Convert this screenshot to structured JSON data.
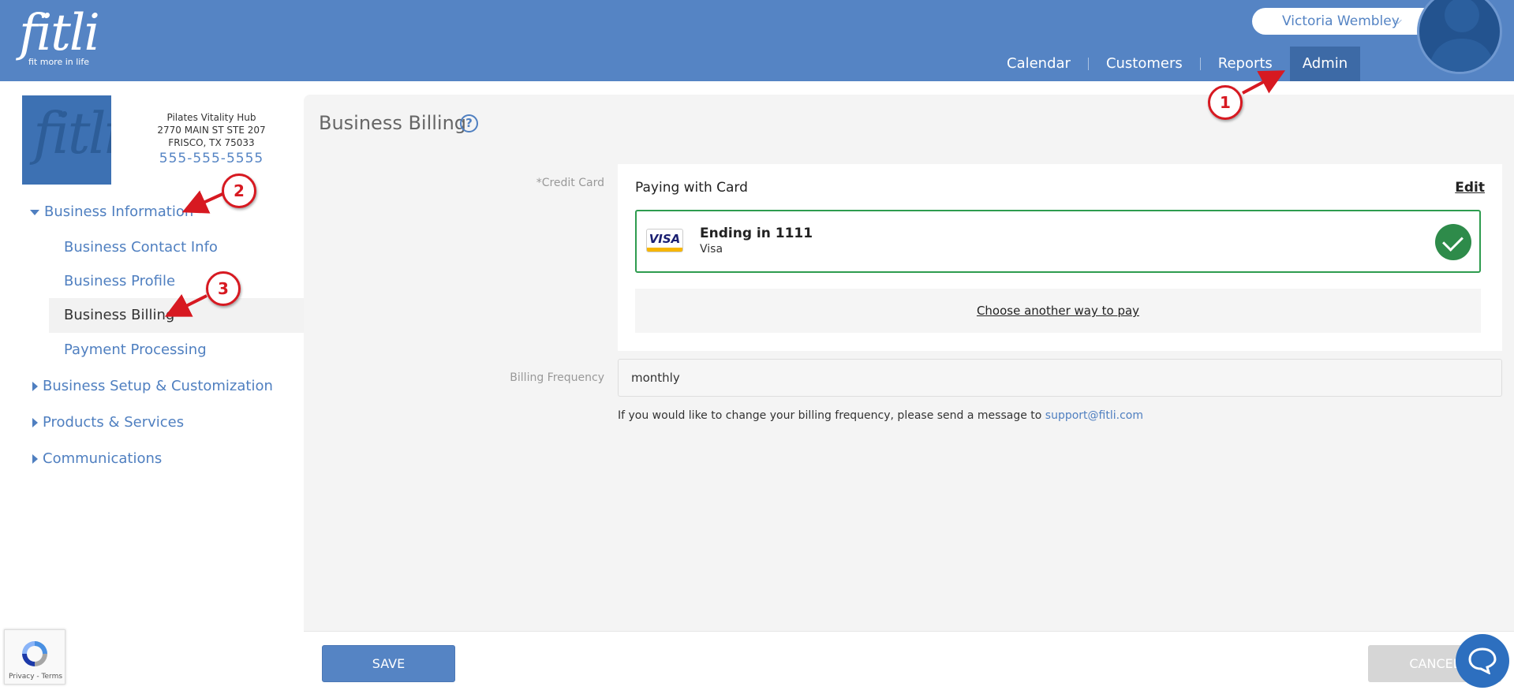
{
  "header": {
    "brand": "fitli",
    "brand_tagline": "fit more in life",
    "user_name": "Victoria Wembley",
    "nav": [
      "Calendar",
      "Customers",
      "Reports",
      "Admin"
    ],
    "active_nav": "Admin"
  },
  "business": {
    "logo": "fitli",
    "name": "Pilates Vitality Hub",
    "address_line1": "2770 MAIN ST STE 207",
    "address_line2": "FRISCO, TX 75033",
    "phone": "555-555-5555"
  },
  "sidebar": {
    "groups": [
      {
        "label": "Business Information",
        "expanded": true,
        "items": [
          "Business Contact Info",
          "Business Profile",
          "Business Billing",
          "Payment Processing"
        ]
      },
      {
        "label": "Business Setup & Customization",
        "expanded": false
      },
      {
        "label": "Products & Services",
        "expanded": false
      },
      {
        "label": "Communications",
        "expanded": false
      }
    ],
    "active_item": "Business Billing"
  },
  "page": {
    "title": "Business Billing",
    "help_icon": "?",
    "credit_card_label": "*Credit Card",
    "paying_title": "Paying with Card",
    "edit_label": "Edit",
    "card": {
      "ending": "Ending in 1111",
      "brand": "Visa",
      "logo_text": "VISA",
      "selected": true
    },
    "choose_label": "Choose another way to pay",
    "billing_frequency_label": "Billing Frequency",
    "billing_frequency_value": "monthly",
    "note_text": "If you would like to change your billing frequency, please send a message to ",
    "support_email": "support@fitli.com"
  },
  "footer": {
    "save_label": "SAVE",
    "cancel_label": "CANCEL"
  },
  "recaptcha": {
    "text": "Privacy - Terms"
  },
  "annotations": [
    "1",
    "2",
    "3"
  ],
  "colors": {
    "header_bg": "#5584c4",
    "active_nav_bg": "#3d6aa6",
    "link": "#4f7fc0",
    "success": "#2e9c4f",
    "annotation": "#d71921"
  }
}
